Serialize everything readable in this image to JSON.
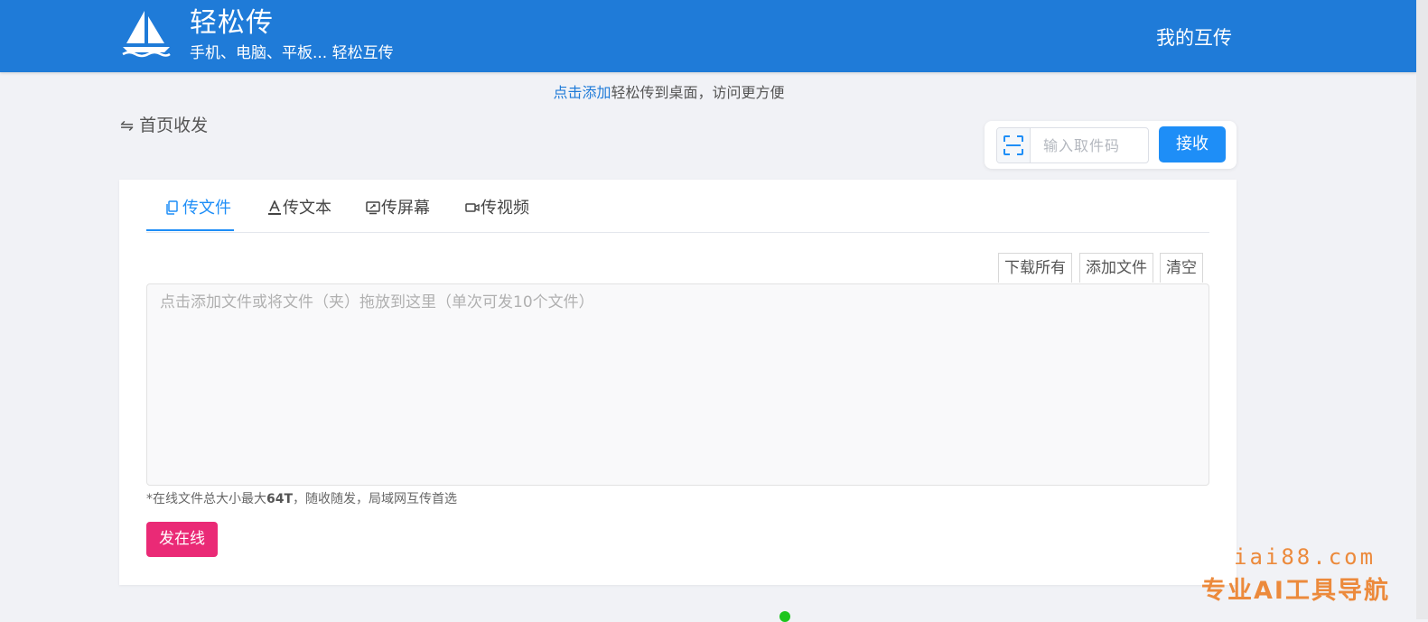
{
  "header": {
    "app_name": "轻松传",
    "tagline": "手机、电脑、平板... 轻松互传",
    "nav_my": "我的互传",
    "logo_icon": "sailboat-icon"
  },
  "notice": {
    "link_text": "点击添加",
    "rest_text": "轻松传到桌面，访问更方便"
  },
  "page_title": {
    "icon": "swap-arrows-icon",
    "text": "首页收发"
  },
  "receive": {
    "scan_icon": "scan-icon",
    "placeholder": "输入取件码",
    "value": "",
    "button_label": "接收"
  },
  "tabs": [
    {
      "label": "传文件",
      "icon": "file-copy-icon",
      "active": true
    },
    {
      "label": "传文本",
      "icon": "text-a-icon",
      "active": false
    },
    {
      "label": "传屏幕",
      "icon": "screen-share-icon",
      "active": false
    },
    {
      "label": "传视频",
      "icon": "video-camera-icon",
      "active": false
    }
  ],
  "file_actions": {
    "download_all": "下载所有",
    "add_file": "添加文件",
    "clear": "清空"
  },
  "dropzone": {
    "hint": "点击添加文件或将文件（夹）拖放到这里（单次可发10个文件）"
  },
  "note": {
    "prefix": "*在线文件总大小最大",
    "bold": "64T",
    "suffix": "，随收随发，局域网互传首选"
  },
  "send_button": "发在线",
  "watermark": {
    "url": "iai88.com",
    "subtitle": "专业AI工具导航"
  },
  "colors": {
    "header": "#1f7bd8",
    "primary": "#1e8ef7",
    "send": "#ea2a76",
    "watermark": "#ec8a3c"
  }
}
